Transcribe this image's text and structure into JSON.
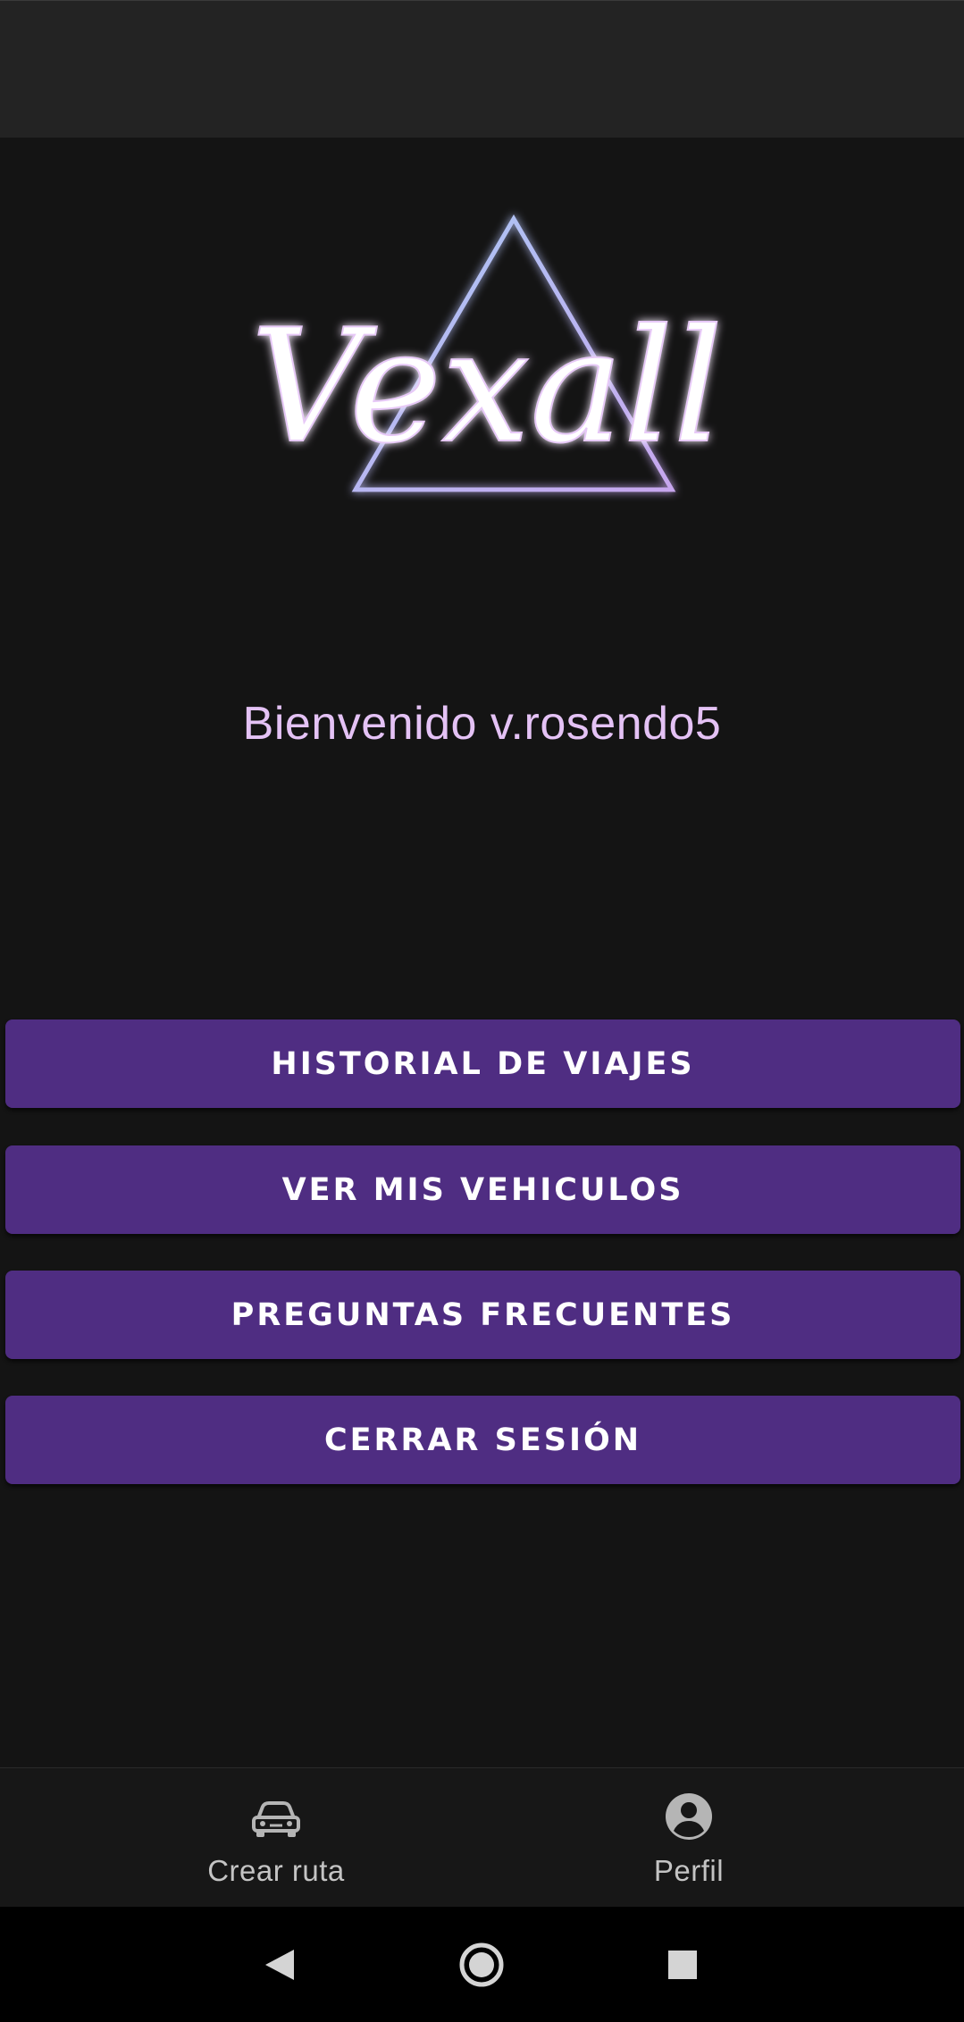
{
  "app": {
    "logo_text": "Vexall",
    "welcome": "Bienvenido v.rosendo5"
  },
  "menu": {
    "buttons": [
      {
        "label": "HISTORIAL DE VIAJES"
      },
      {
        "label": "VER MIS VEHICULOS"
      },
      {
        "label": "PREGUNTAS FRECUENTES"
      },
      {
        "label": "CERRAR SESIÓN"
      }
    ]
  },
  "bottom_nav": {
    "items": [
      {
        "label": "Crear ruta",
        "icon": "car-icon"
      },
      {
        "label": "Perfil",
        "icon": "account-circle-icon"
      }
    ]
  },
  "system_nav": {
    "icons": [
      "back-icon",
      "home-icon",
      "recents-icon"
    ]
  },
  "colors": {
    "background": "#141414",
    "button": "#4f2d82",
    "welcome_text": "#e4c2f5",
    "status_bar": "#232323"
  }
}
